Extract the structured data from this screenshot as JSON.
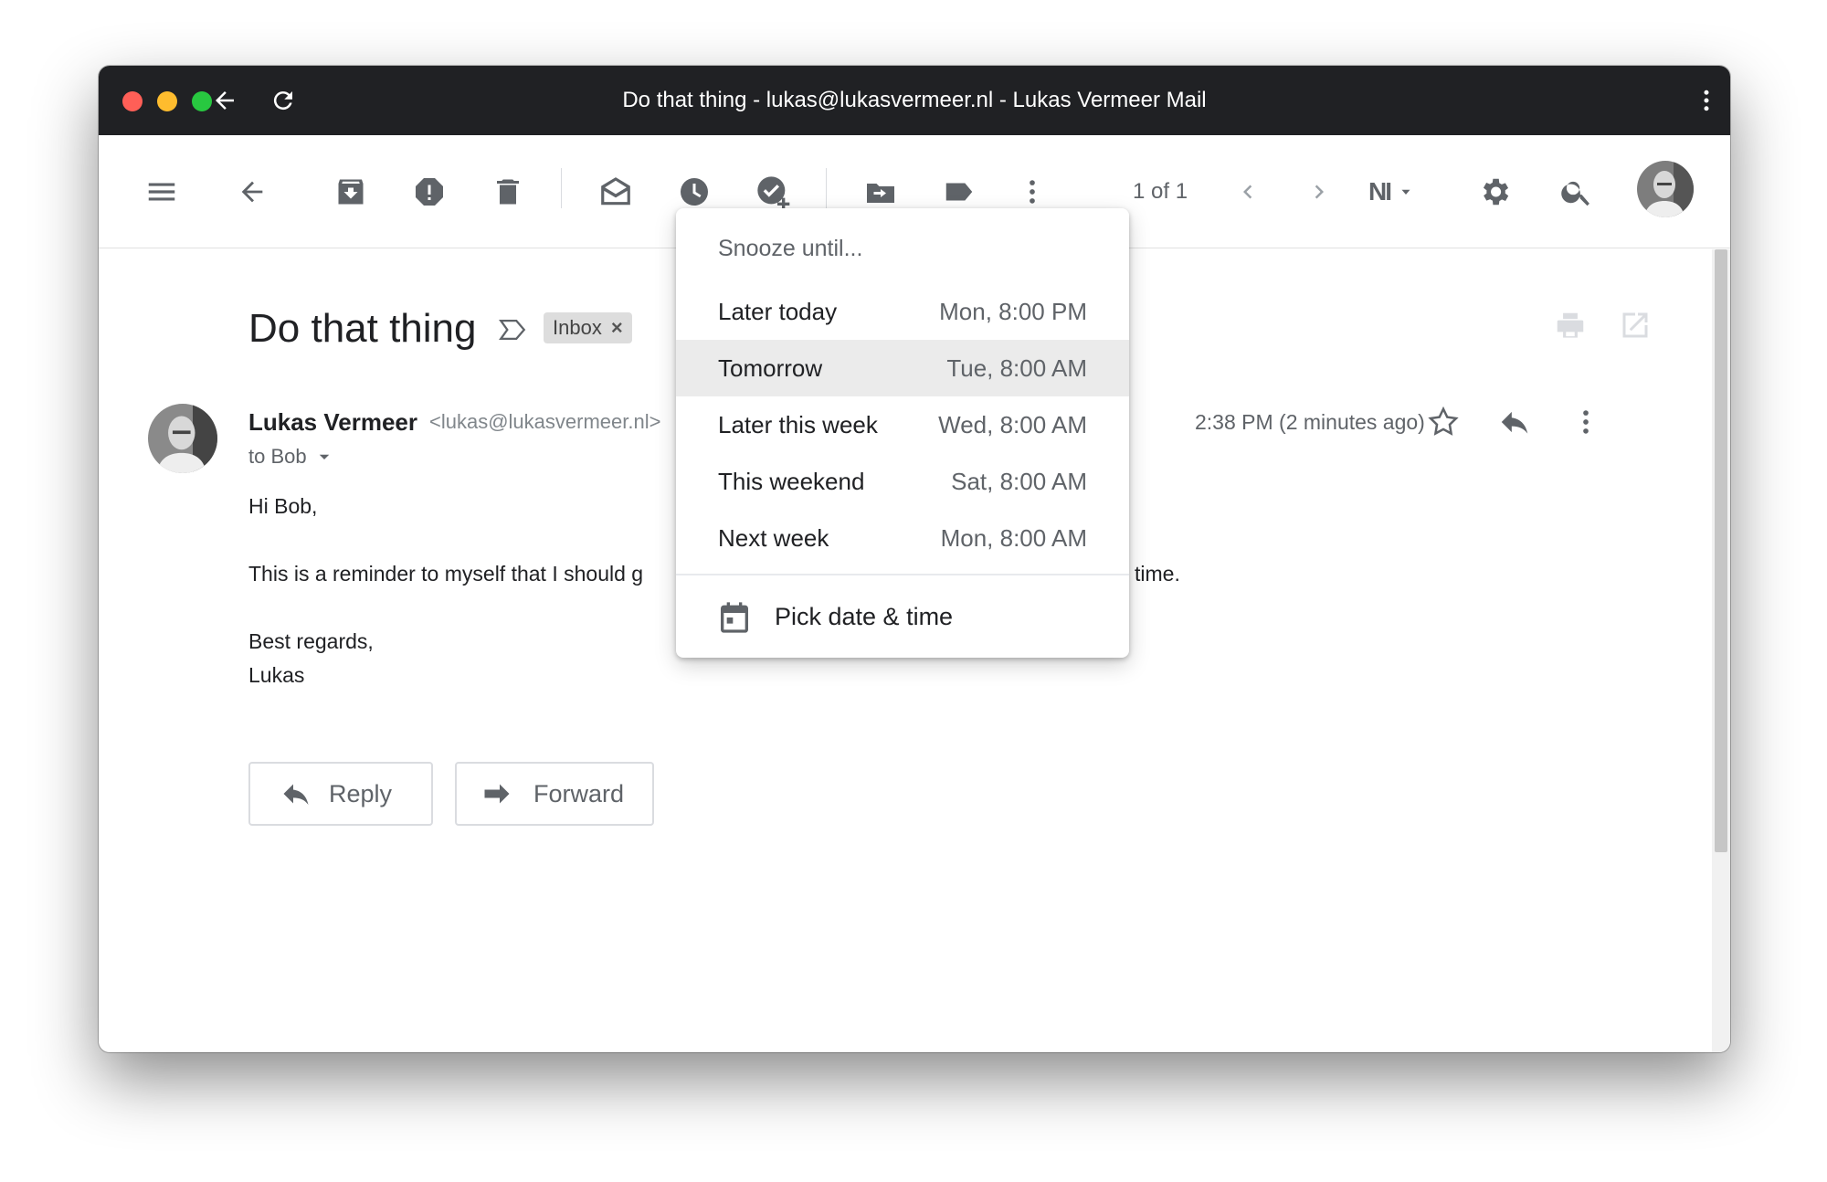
{
  "window": {
    "title": "Do that thing - lukas@lukasvermeer.nl - Lukas Vermeer Mail"
  },
  "toolbar": {
    "icons": [
      "menu-icon",
      "back-arrow-icon",
      "archive-icon",
      "report-spam-icon",
      "delete-icon",
      "mark-unread-icon",
      "snooze-icon",
      "add-task-icon",
      "move-to-icon",
      "label-icon",
      "more-vert-icon",
      "chevron-left-icon",
      "chevron-right-icon",
      "input-tools-icon",
      "settings-icon",
      "search-icon"
    ],
    "pager": "1 of 1",
    "input_tool_label": "NI"
  },
  "email": {
    "subject": "Do that thing",
    "label_chip": "Inbox",
    "label_close": "×",
    "sender_name": "Lukas Vermeer",
    "sender_email": "<lukas@lukasvermeer.nl>",
    "to": "to Bob",
    "timestamp": "2:38 PM (2 minutes ago)",
    "body": {
      "greeting": "Hi Bob,",
      "line_part1": "This is a reminder to myself that I should g",
      "line_part2": "time.",
      "closing": "Best regards,",
      "signature": "Lukas"
    }
  },
  "actions": {
    "reply_label": "Reply",
    "forward_label": "Forward"
  },
  "snooze_menu": {
    "header": "Snooze until...",
    "options": [
      {
        "label": "Later today",
        "time": "Mon, 8:00 PM"
      },
      {
        "label": "Tomorrow",
        "time": "Tue, 8:00 AM"
      },
      {
        "label": "Later this week",
        "time": "Wed, 8:00 AM"
      },
      {
        "label": "This weekend",
        "time": "Sat, 8:00 AM"
      },
      {
        "label": "Next week",
        "time": "Mon, 8:00 AM"
      }
    ],
    "highlighted_option": "Tomorrow",
    "pick_label": "Pick date & time"
  },
  "colors": {
    "titlebar": "#202124",
    "icon_gray": "#5f6368",
    "menu_highlight": "#ebebeb",
    "traffic_red": "#ff5f57",
    "traffic_yellow": "#febc2e",
    "traffic_green": "#28c840"
  }
}
